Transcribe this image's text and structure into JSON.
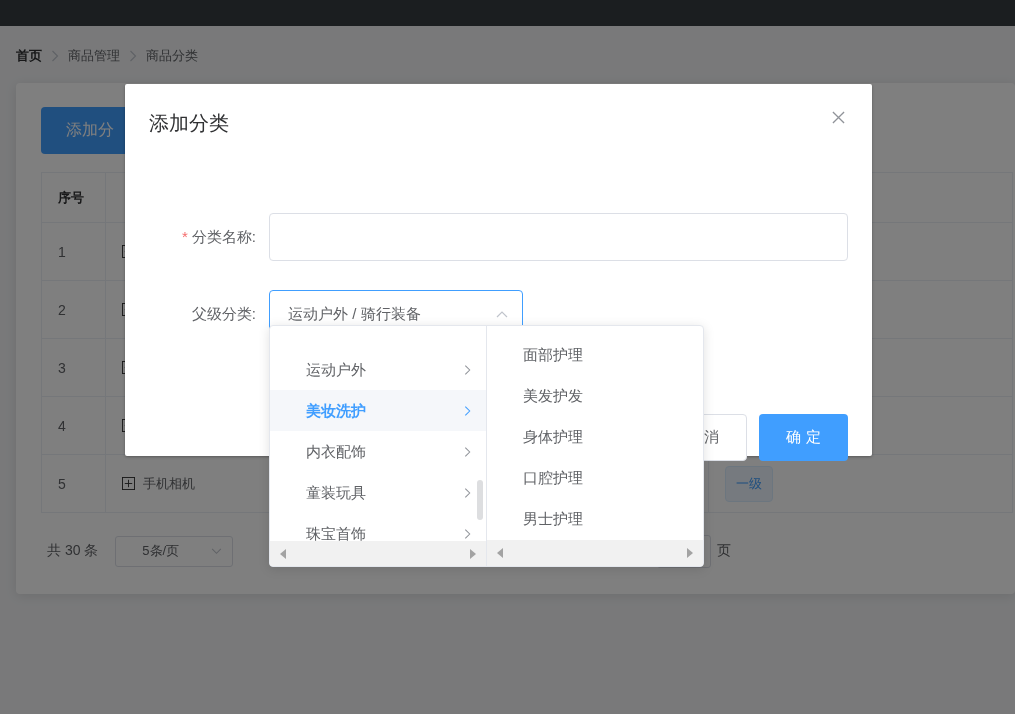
{
  "breadcrumb": [
    {
      "label": "首页"
    },
    {
      "label": "商品管理"
    },
    {
      "label": "商品分类"
    }
  ],
  "add_button": "添加分",
  "table": {
    "columns": [
      "序号"
    ],
    "rows": [
      {
        "index": "1"
      },
      {
        "index": "2"
      },
      {
        "index": "3"
      },
      {
        "index": "4"
      },
      {
        "index": "5",
        "name": "手机相机",
        "level": "一级"
      }
    ]
  },
  "pagination": {
    "total": "共 30 条",
    "page_size": "5条/页",
    "jump_suffix": "页"
  },
  "dialog": {
    "title": "添加分类",
    "fields": [
      {
        "kind": "input",
        "required_mark": "*",
        "label": "分类名称:"
      },
      {
        "kind": "cascader",
        "label": "父级分类:",
        "value": "运动户外 / 骑行装备",
        "expanded": true
      }
    ],
    "buttons": [
      {
        "kind": "default",
        "label": "消"
      },
      {
        "kind": "primary",
        "label": "确 定"
      }
    ]
  },
  "cascader_menu": {
    "columns": [
      [
        {
          "label": "运动户外",
          "selected": false,
          "has_children": true
        },
        {
          "label": "美妆洗护",
          "selected": true,
          "has_children": true
        },
        {
          "label": "内衣配饰",
          "selected": false,
          "has_children": true
        },
        {
          "label": "童装玩具",
          "selected": false,
          "has_children": true
        },
        {
          "label": "珠宝首饰",
          "selected": false,
          "has_children": true
        }
      ],
      [
        {
          "label": "面部护理",
          "selected": false,
          "has_children": false
        },
        {
          "label": "美发护发",
          "selected": false,
          "has_children": false
        },
        {
          "label": "身体护理",
          "selected": false,
          "has_children": false
        },
        {
          "label": "口腔护理",
          "selected": false,
          "has_children": false
        },
        {
          "label": "男士护理",
          "selected": false,
          "has_children": false
        }
      ]
    ]
  }
}
